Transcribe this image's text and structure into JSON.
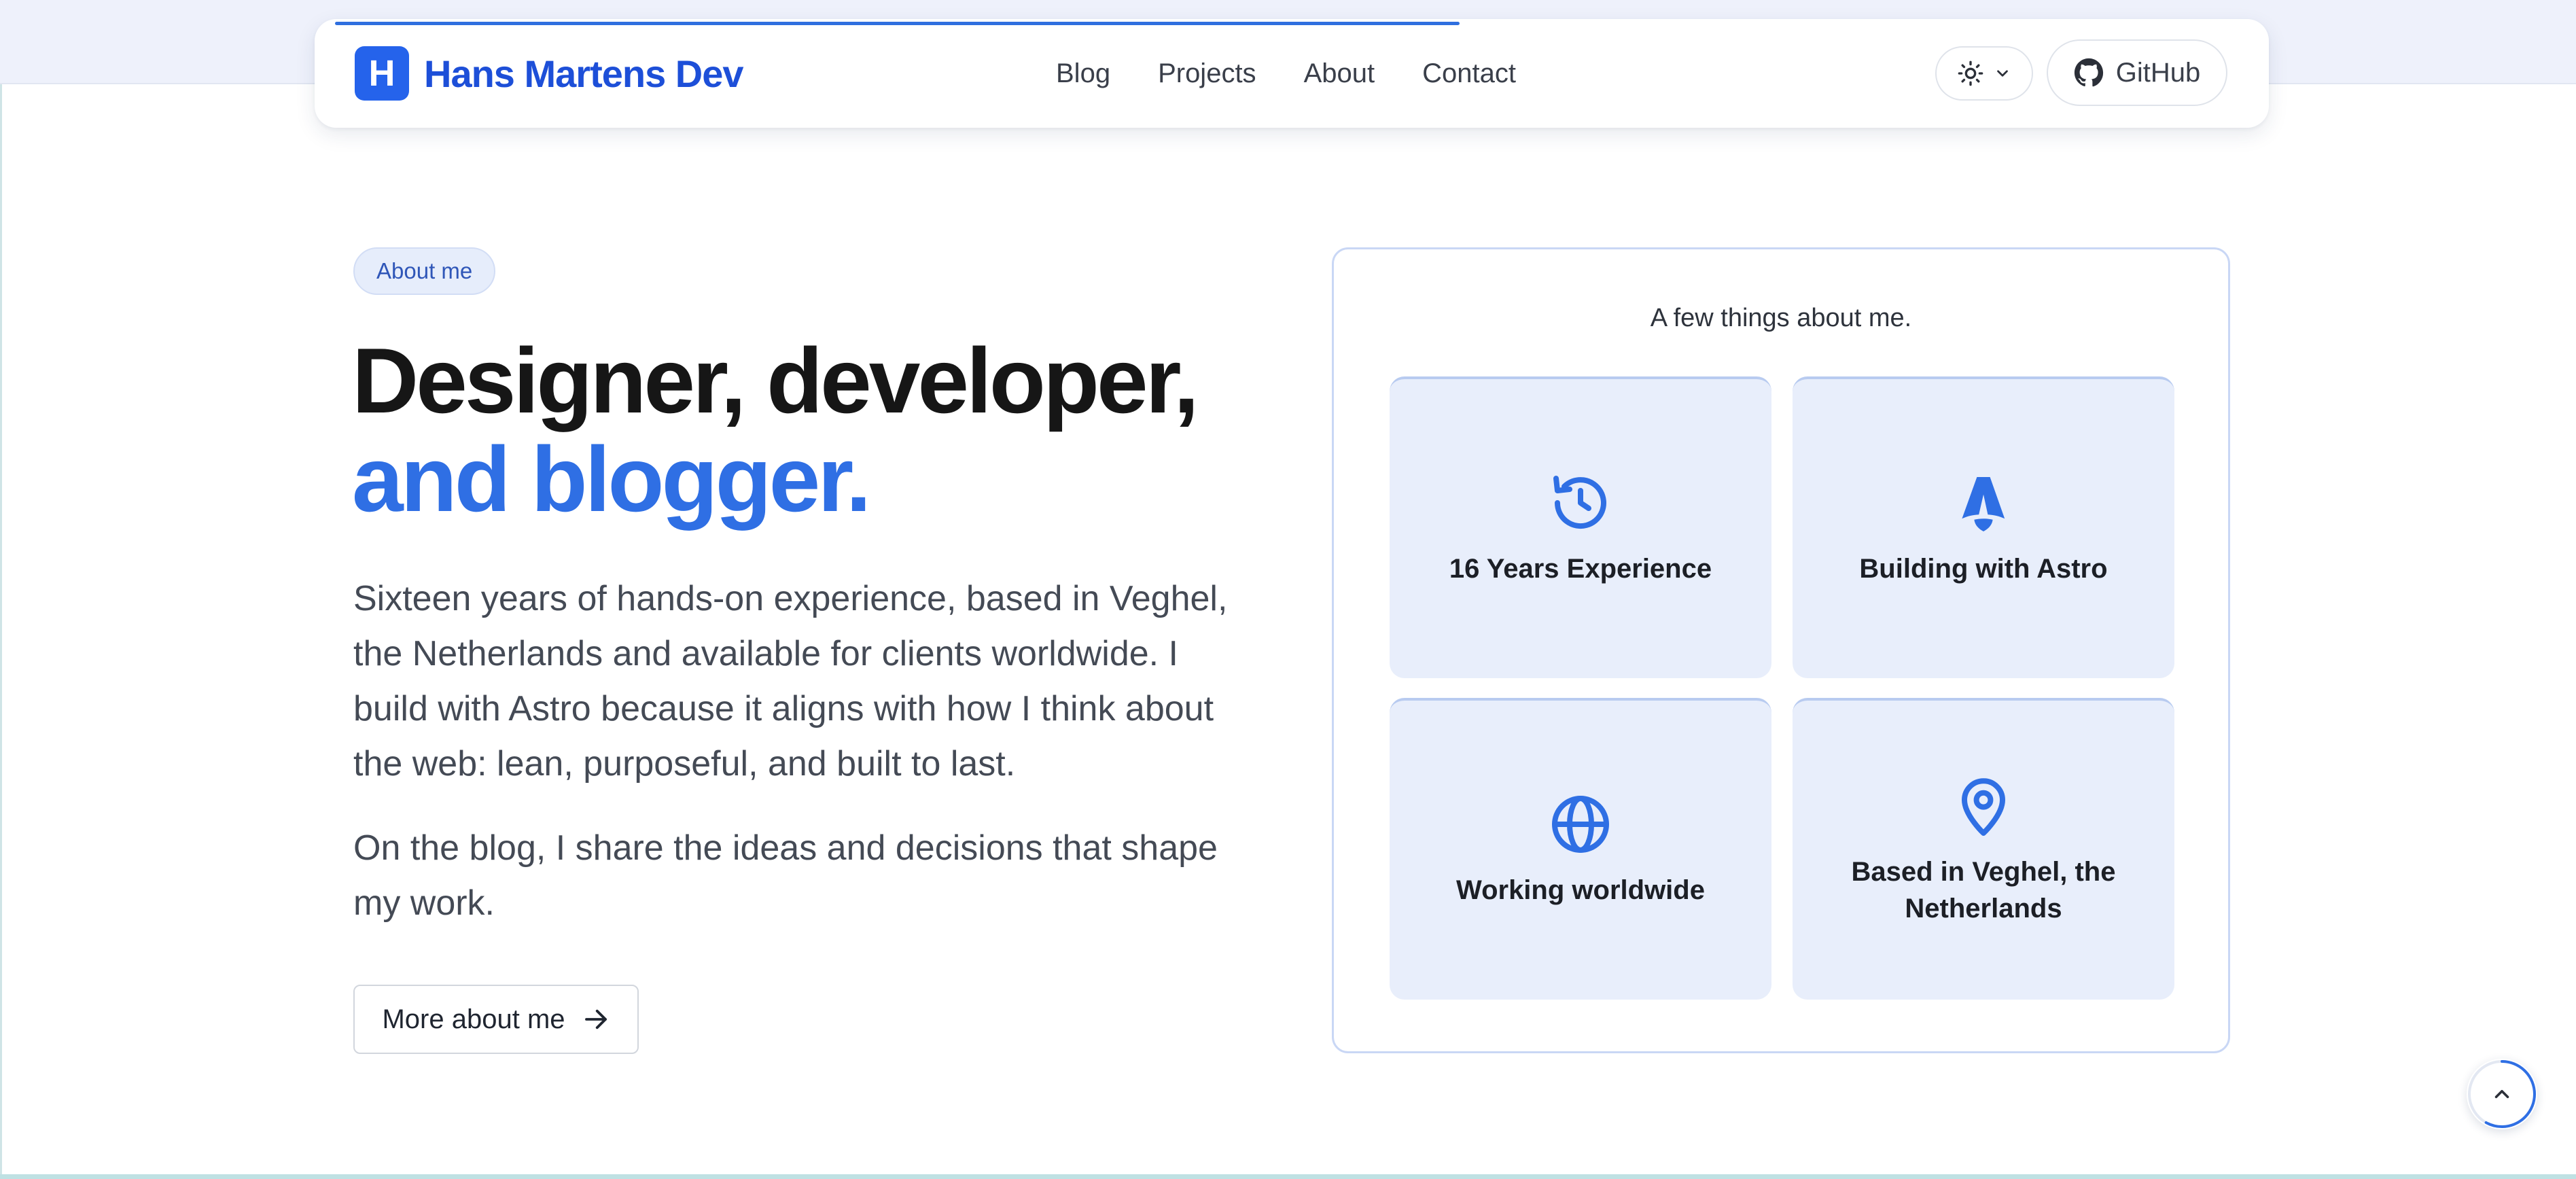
{
  "header": {
    "logo_letter": "H",
    "logo_text": "Hans Martens Dev",
    "nav": [
      "Blog",
      "Projects",
      "About",
      "Contact"
    ],
    "github_label": "GitHub",
    "reading_progress_fraction": 0.58
  },
  "hero": {
    "badge": "About me",
    "headline_line1": "Designer, developer,",
    "headline_line2": "and blogger.",
    "paragraph1": "Sixteen years of hands-on experience, based in Veghel, the Netherlands and available for clients worldwide. I build with Astro because it aligns with how I think about the web: lean, purposeful, and built to last.",
    "paragraph2": "On the blog, I share the ideas and decisions that shape my work.",
    "cta_label": "More about me"
  },
  "facts": {
    "title": "A few things about me.",
    "tiles": [
      {
        "label": "16 Years Experience",
        "icon": "history-icon"
      },
      {
        "label": "Building with Astro",
        "icon": "astro-icon"
      },
      {
        "label": "Working worldwide",
        "icon": "globe-icon"
      },
      {
        "label": "Based in Veghel, the Netherlands",
        "icon": "map-pin-icon"
      }
    ]
  },
  "colors": {
    "accent": "#2f6fe4",
    "brand": "#2563eb",
    "tile_bg": "#e8eefb",
    "top_band": "#eef1fb"
  }
}
